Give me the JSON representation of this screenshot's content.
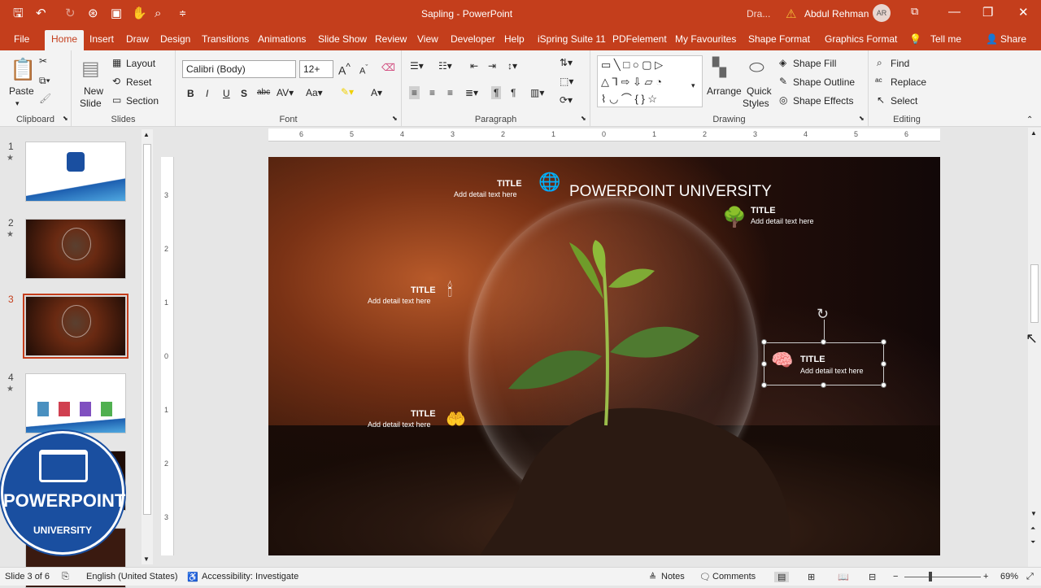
{
  "window": {
    "title": "Sapling  -  PowerPoint",
    "draw_label": "Dra...",
    "user": "Abdul Rehman",
    "avatar": "AR",
    "min": "—",
    "restore": "❐",
    "close": "✕",
    "ribbon_toggle": "⧉"
  },
  "tabs": [
    "File",
    "Home",
    "Insert",
    "Draw",
    "Design",
    "Transitions",
    "Animations",
    "Slide Show",
    "Review",
    "View",
    "Developer",
    "Help",
    "iSpring Suite 11",
    "PDFelement",
    "My Favourites",
    "Shape Format",
    "Graphics Format"
  ],
  "tell_me": "Tell me",
  "share": "Share",
  "ribbon": {
    "clipboard": {
      "label": "Clipboard",
      "paste": "Paste"
    },
    "slides": {
      "label": "Slides",
      "new_slide": "New",
      "new_slide2": "Slide",
      "layout": "Layout",
      "reset": "Reset",
      "section": "Section"
    },
    "font": {
      "label": "Font",
      "family": "Calibri (Body)",
      "size": "12+"
    },
    "paragraph": {
      "label": "Paragraph"
    },
    "drawing": {
      "label": "Drawing",
      "arrange": "Arrange",
      "quick": "Quick",
      "styles": "Styles",
      "fill": "Shape Fill",
      "outline": "Shape Outline",
      "effects": "Shape Effects"
    },
    "editing": {
      "label": "Editing",
      "find": "Find",
      "replace": "Replace",
      "select": "Select"
    }
  },
  "thumbnails": [
    {
      "num": "1",
      "star": "★"
    },
    {
      "num": "2",
      "star": "★"
    },
    {
      "num": "3",
      "star": ""
    },
    {
      "num": "4",
      "star": "★"
    }
  ],
  "ruler_h": [
    "6",
    "5",
    "4",
    "3",
    "2",
    "1",
    "0",
    "1",
    "2",
    "3",
    "4",
    "5",
    "6"
  ],
  "ruler_v": [
    "3",
    "2",
    "1",
    "0",
    "1",
    "2",
    "3"
  ],
  "slide": {
    "heading": "POWERPOINT UNIVERSITY",
    "items": [
      {
        "title": "TITLE",
        "detail": "Add detail text here"
      },
      {
        "title": "TITLE",
        "detail": "Add detail text here"
      },
      {
        "title": "TITLE",
        "detail": "Add detail text here"
      },
      {
        "title": "TITLE",
        "detail": "Add detail text here"
      },
      {
        "title": "TITLE",
        "detail": "Add detail text here"
      }
    ]
  },
  "logo": {
    "line1": "POWERPOINT",
    "line2": "UNIVERSITY"
  },
  "status": {
    "slide": "Slide 3 of 6",
    "language": "English (United States)",
    "accessibility": "Accessibility: Investigate",
    "notes": "Notes",
    "comments": "Comments",
    "zoom": "69%"
  }
}
